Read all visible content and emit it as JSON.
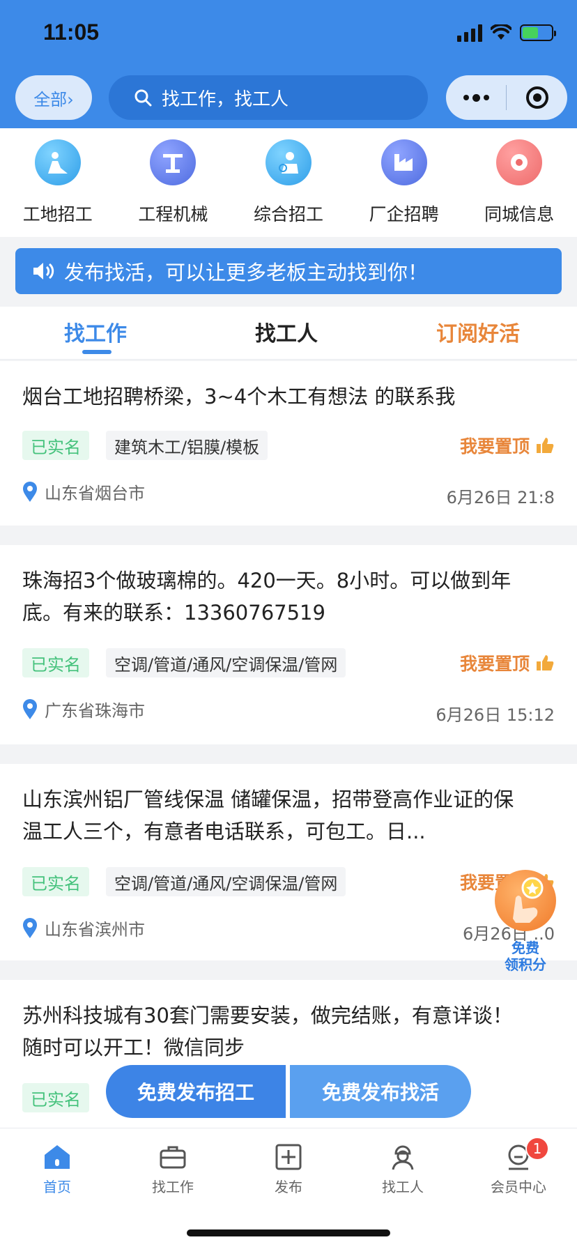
{
  "status_bar": {
    "time": "11:05"
  },
  "header": {
    "scope_label": "全部›",
    "search_placeholder": "找工作，找工人"
  },
  "categories": [
    {
      "label": "工地招工",
      "icon": "construction-worker-icon",
      "color": "#3fb2f0"
    },
    {
      "label": "工程机械",
      "icon": "machinery-icon",
      "color": "#5a7de8"
    },
    {
      "label": "综合招工",
      "icon": "general-recruit-icon",
      "color": "#3fb2f0"
    },
    {
      "label": "厂企招聘",
      "icon": "factory-icon",
      "color": "#5a7de8"
    },
    {
      "label": "同城信息",
      "icon": "location-pin-icon",
      "color": "#f06a6a"
    }
  ],
  "notice": {
    "text": "发布找活，可以让更多老板主动找到你！"
  },
  "tabs": {
    "find_job": "找工作",
    "find_worker": "找工人",
    "subscribe": "订阅好活"
  },
  "jobs": [
    {
      "title": "烟台工地招聘桥梁，3~4个木工有想法 的联系我",
      "verified": "已实名",
      "tag": "建筑木工/铝膜/模板",
      "pin_action": "我要置顶",
      "location": "山东省烟台市",
      "date": "6月26日  21:8"
    },
    {
      "title": "珠海招3个做玻璃棉的。420一天。8小时。可以做到年底。有来的联系：13360767519",
      "verified": "已实名",
      "tag": "空调/管道/通风/空调保温/管网",
      "pin_action": "我要置顶",
      "location": "广东省珠海市",
      "date": "6月26日  15:12"
    },
    {
      "title": "山东滨州铝厂管线保温 储罐保温，招带登高作业证的保温工人三个，有意者电话联系，可包工。日...",
      "verified": "已实名",
      "tag": "空调/管道/通风/空调保温/管网",
      "pin_action": "我要置顶",
      "location": "山东省滨州市",
      "date": "6月26日  ..0"
    },
    {
      "title": "苏州科技城有30套门需要安装，做完结账，有意详谈！随时可以开工！微信同步",
      "verified": "已实名"
    }
  ],
  "reward": {
    "line1": "免费",
    "line2": "领积分"
  },
  "publish": {
    "recruit": "免费发布招工",
    "find_work": "免费发布找活"
  },
  "bottom_nav": [
    {
      "label": "首页"
    },
    {
      "label": "找工作"
    },
    {
      "label": "发布"
    },
    {
      "label": "找工人"
    },
    {
      "label": "会员中心",
      "badge": "1"
    }
  ],
  "colors": {
    "primary": "#3d8ae8",
    "accent_orange": "#e8863a",
    "verified_green": "#45c27c"
  }
}
